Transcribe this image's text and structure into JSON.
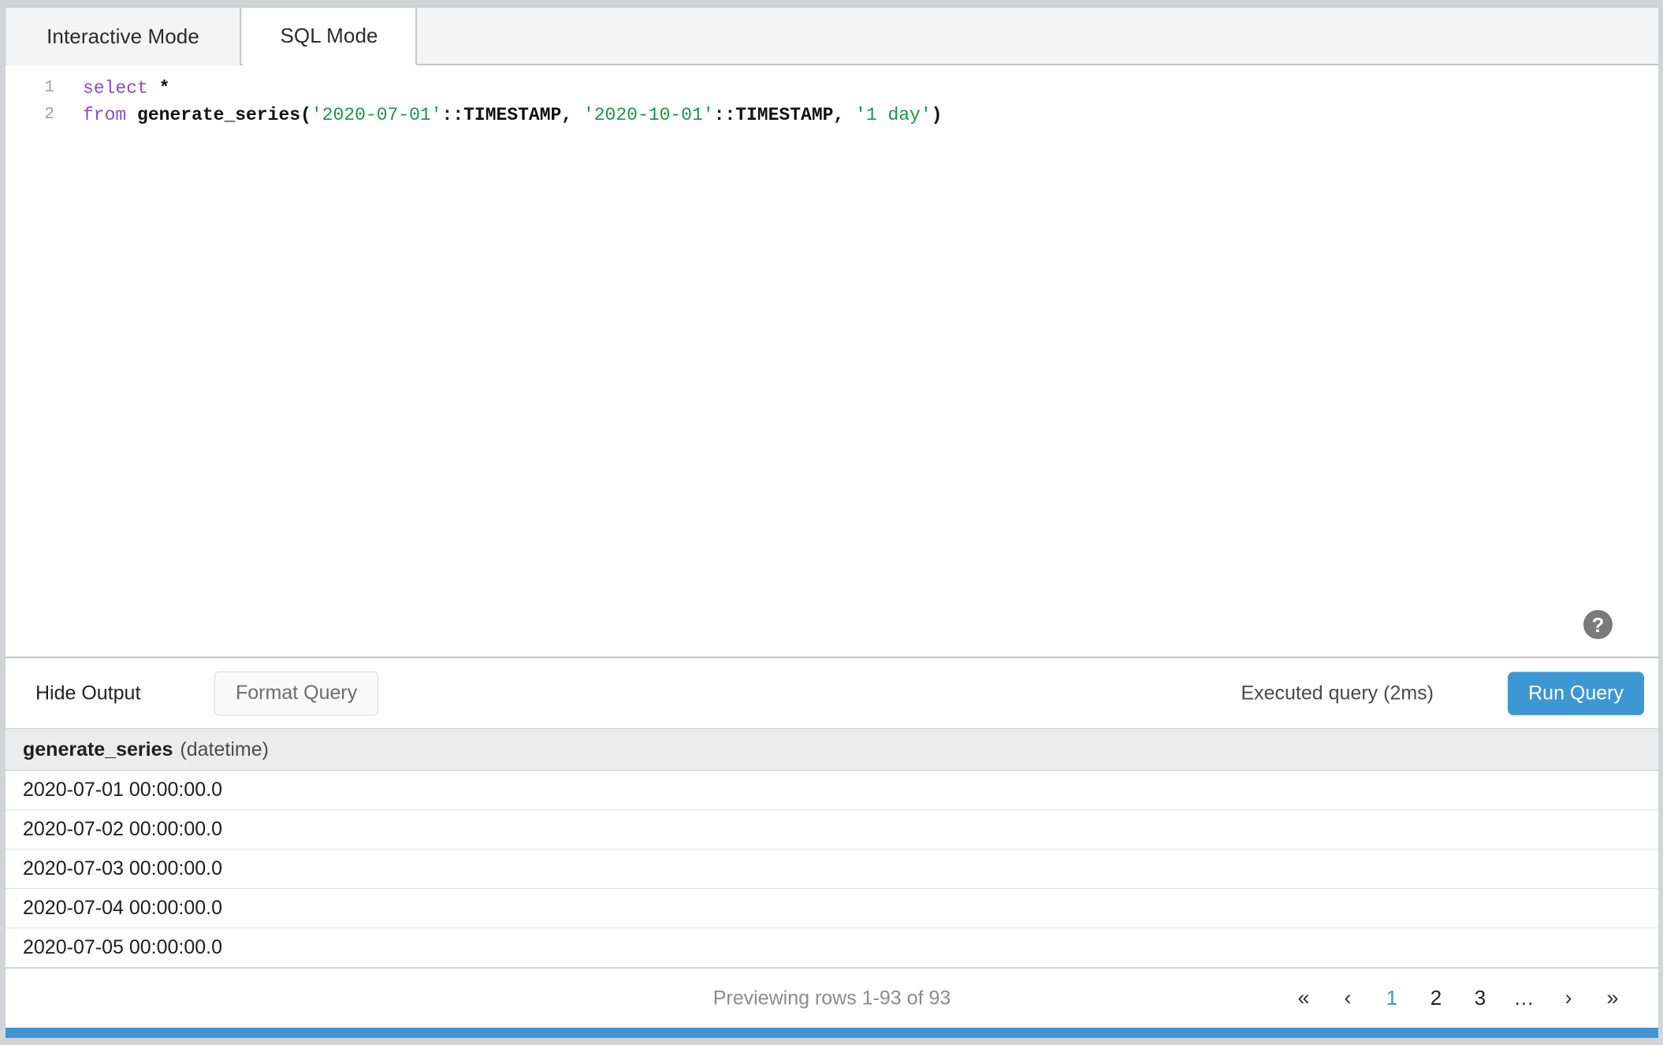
{
  "tabs": [
    {
      "label": "Interactive Mode",
      "active": false
    },
    {
      "label": "SQL Mode",
      "active": true
    }
  ],
  "editor": {
    "lines": [
      {
        "number": "1",
        "tokens": [
          {
            "text": "select",
            "kind": "kw"
          },
          {
            "text": " ",
            "kind": "plain"
          },
          {
            "text": "*",
            "kind": "op"
          }
        ]
      },
      {
        "number": "2",
        "tokens": [
          {
            "text": "from",
            "kind": "kw"
          },
          {
            "text": " ",
            "kind": "plain"
          },
          {
            "text": "generate_series(",
            "kind": "fn"
          },
          {
            "text": "'2020-07-01'",
            "kind": "str"
          },
          {
            "text": "::TIMESTAMP, ",
            "kind": "fn"
          },
          {
            "text": "'2020-10-01'",
            "kind": "str"
          },
          {
            "text": "::TIMESTAMP, ",
            "kind": "fn"
          },
          {
            "text": "'1 day'",
            "kind": "str"
          },
          {
            "text": ")",
            "kind": "fn"
          }
        ]
      }
    ],
    "plain_text": "select *\nfrom generate_series('2020-07-01'::TIMESTAMP, '2020-10-01'::TIMESTAMP, '1 day')",
    "help_icon": "help-circle-icon",
    "help_glyph": "?"
  },
  "toolbar": {
    "hide_output_label": "Hide Output",
    "format_query_label": "Format Query",
    "exec_status": "Executed query (2ms)",
    "run_query_label": "Run Query",
    "run_query_color": "#3d97d3"
  },
  "results": {
    "column": {
      "name": "generate_series",
      "type": "(datetime)"
    },
    "rows": [
      {
        "value": "2020-07-01 00:00:00.0"
      },
      {
        "value": "2020-07-02 00:00:00.0"
      },
      {
        "value": "2020-07-03 00:00:00.0"
      },
      {
        "value": "2020-07-04 00:00:00.0"
      },
      {
        "value": "2020-07-05 00:00:00.0"
      }
    ]
  },
  "footer": {
    "preview_text": "Previewing rows 1-93 of 93",
    "pager": [
      {
        "label": "«",
        "name": "first-page-button",
        "kind": "chev",
        "active": false
      },
      {
        "label": "‹",
        "name": "prev-page-button",
        "kind": "chev",
        "active": false
      },
      {
        "label": "1",
        "name": "page-1-button",
        "kind": "num",
        "active": true
      },
      {
        "label": "2",
        "name": "page-2-button",
        "kind": "num",
        "active": false
      },
      {
        "label": "3",
        "name": "page-3-button",
        "kind": "num",
        "active": false
      },
      {
        "label": "...",
        "name": "page-ellipsis",
        "kind": "dots",
        "active": false
      },
      {
        "label": "›",
        "name": "next-page-button",
        "kind": "chev",
        "active": false
      },
      {
        "label": "»",
        "name": "last-page-button",
        "kind": "chev",
        "active": false
      }
    ],
    "active_page_color": "#3d97d3"
  }
}
